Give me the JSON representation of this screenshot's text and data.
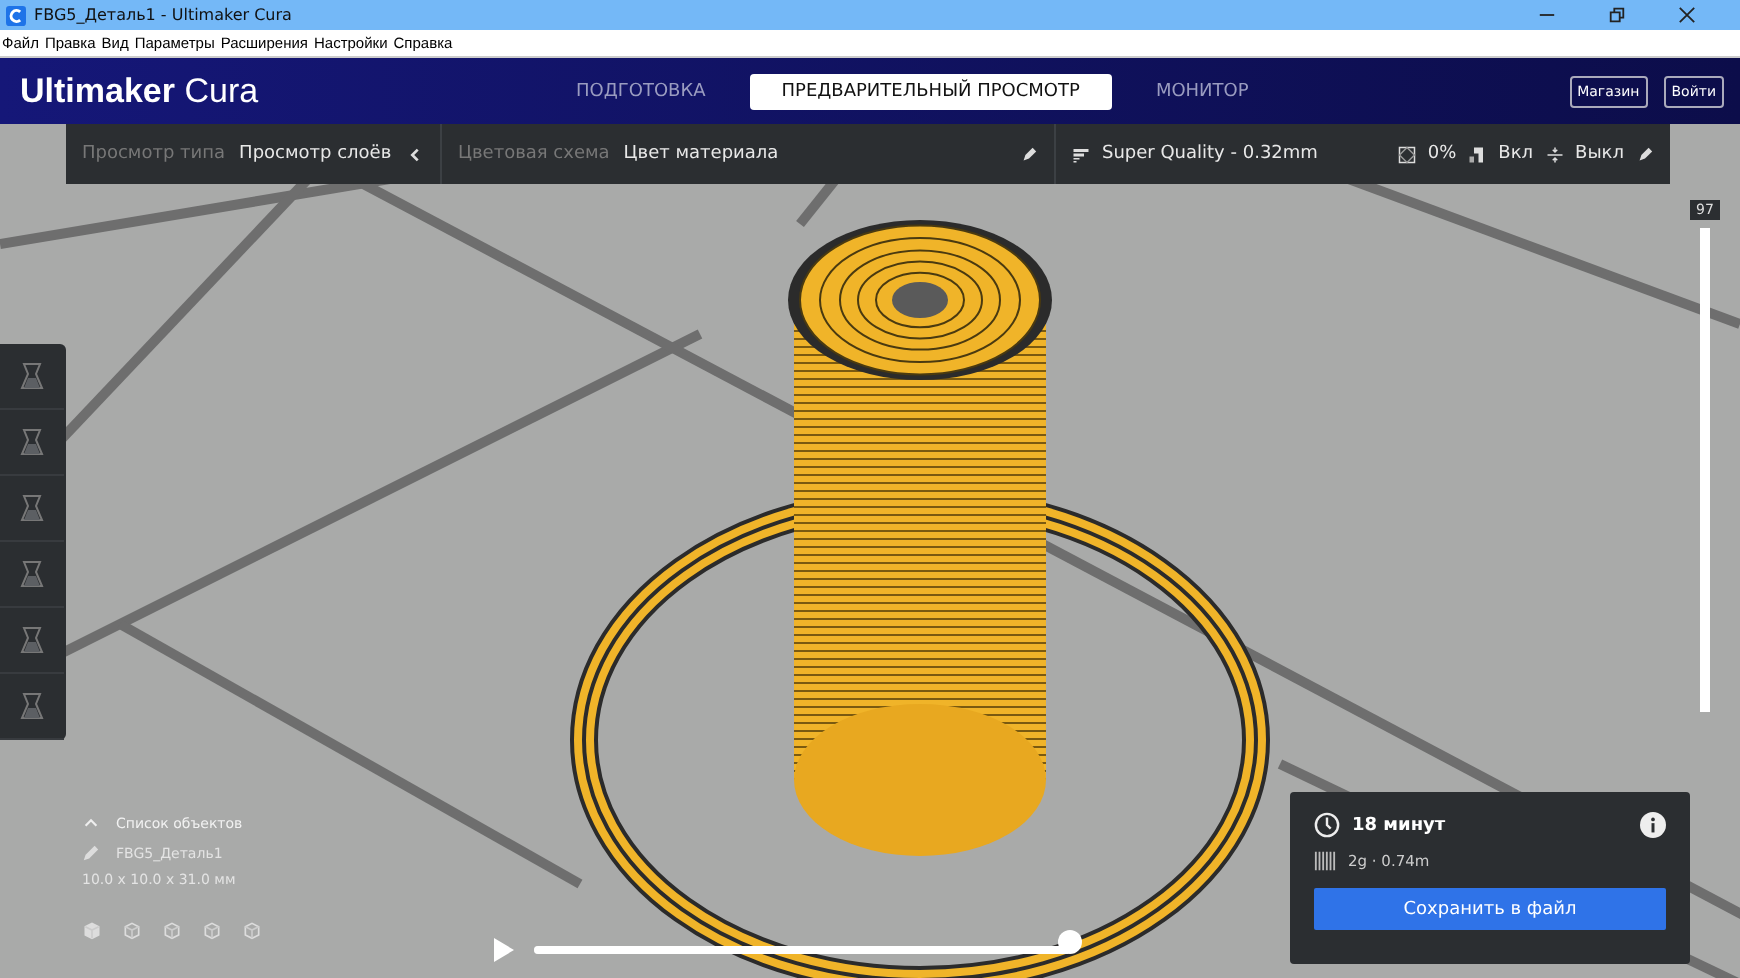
{
  "window": {
    "title": "FBG5_Деталь1 - Ultimaker Cura"
  },
  "menu": [
    "Файл",
    "Правка",
    "Вид",
    "Параметры",
    "Расширения",
    "Настройки",
    "Справка"
  ],
  "header": {
    "logo_bold": "Ultimaker",
    "logo_light": "Cura",
    "tabs": [
      {
        "label": "ПОДГОТОВКА",
        "selected": false
      },
      {
        "label": "ПРЕДВАРИТЕЛЬНЫЙ ПРОСМОТР",
        "selected": true
      },
      {
        "label": "МОНИТОР",
        "selected": false
      }
    ],
    "buttons": [
      "Магазин",
      "Войти"
    ]
  },
  "toolbar": {
    "view_type_label": "Просмотр типа",
    "view_type": "Просмотр слоёв",
    "color_scheme_label": "Цветовая схема",
    "color_scheme": "Цвет материала",
    "profile": "Super Quality - 0.32mm",
    "infill": "0%",
    "support": "Вкл",
    "adhesion": "Выкл"
  },
  "object_list": {
    "title": "Список объектов",
    "expanded": true,
    "object_name": "FBG5_Деталь1",
    "dimensions": "10.0 x 10.0 x 31.0 мм"
  },
  "layer_slider": {
    "label": "97",
    "level": 1
  },
  "playback": {
    "level": 1
  },
  "print_panel": {
    "time": "18 минут",
    "material": "2g · 0.74m",
    "button": "Сохранить в файл"
  }
}
